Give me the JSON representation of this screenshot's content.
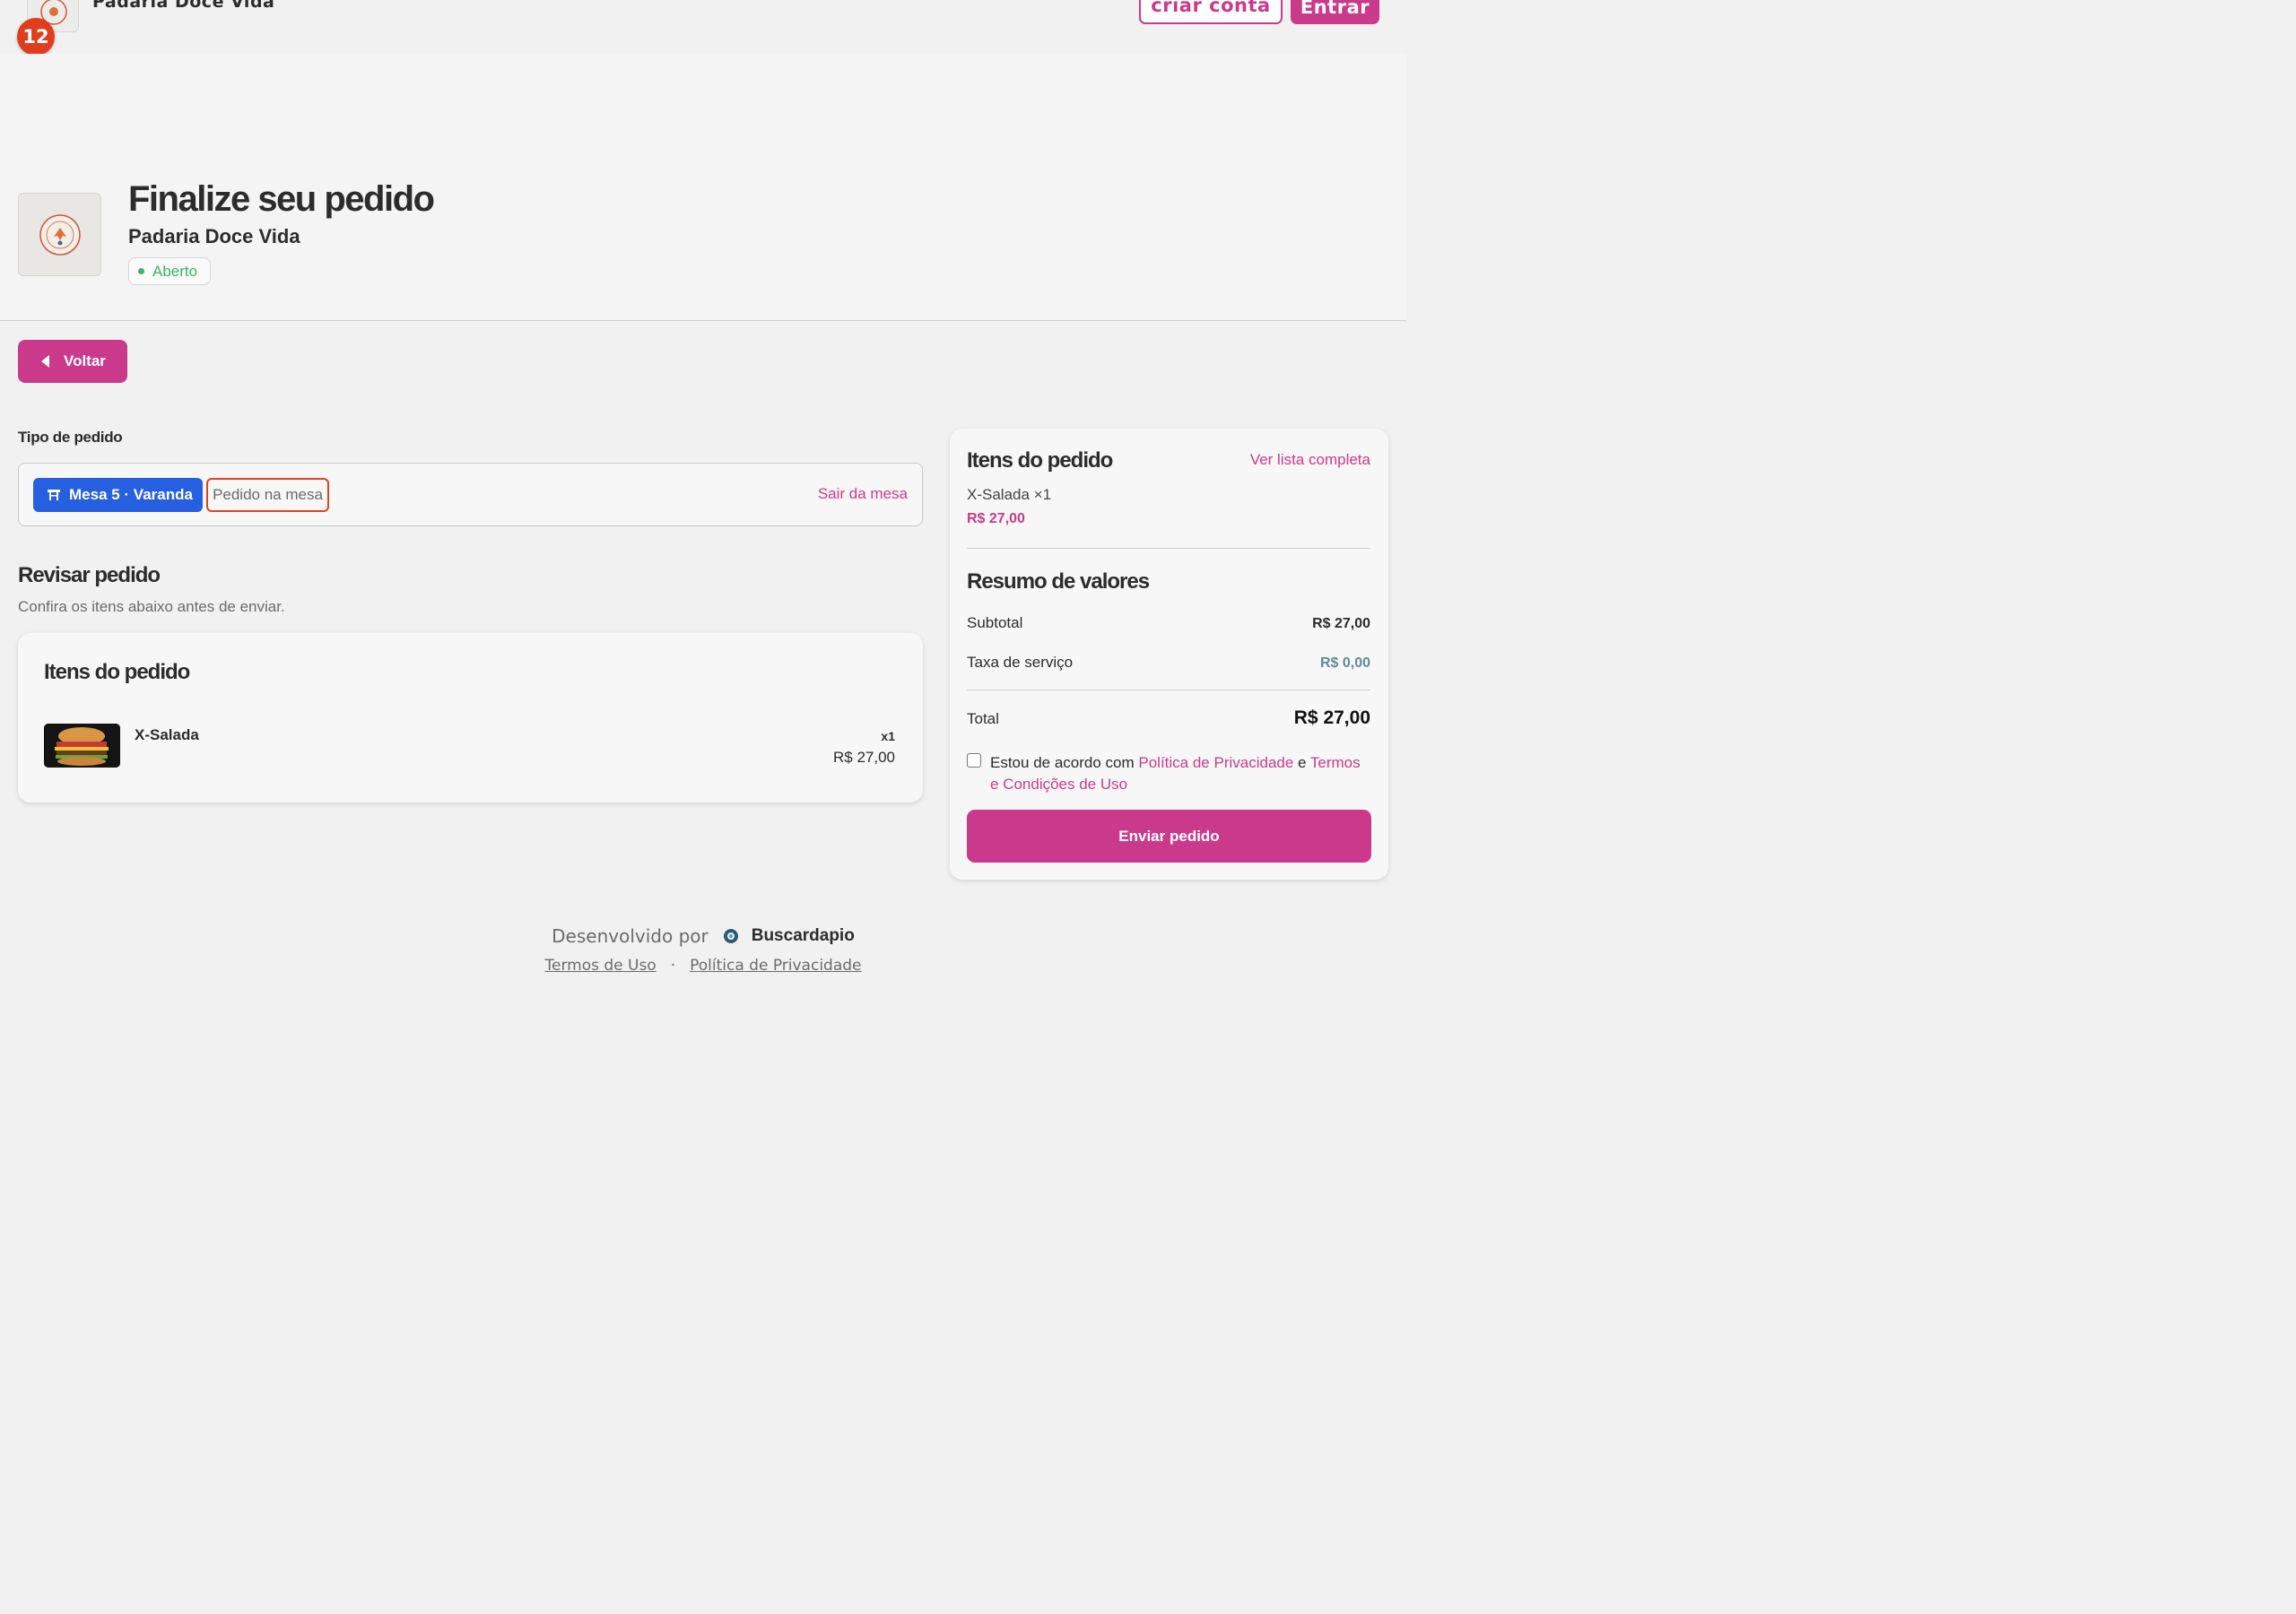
{
  "header": {
    "notification_count": "12",
    "brand_name": "Padaria Doce Vida",
    "criar_conta_label": "criar conta",
    "entrar_label": "Entrar"
  },
  "hero": {
    "title": "Finalize seu pedido",
    "store_name": "Padaria Doce Vida",
    "status": "Aberto"
  },
  "actions": {
    "voltar_label": "Voltar"
  },
  "order_type": {
    "label": "Tipo de pedido",
    "table_chip": "Mesa 5 · Varanda",
    "type_value": "Pedido na mesa",
    "leave_table": "Sair da mesa"
  },
  "review": {
    "title": "Revisar pedido",
    "subtitle": "Confira os itens abaixo antes de enviar.",
    "card_title": "Itens do pedido",
    "items": [
      {
        "name": "X-Salada",
        "qty": "x1",
        "price": "R$ 27,00"
      }
    ]
  },
  "summary": {
    "items_title": "Itens do pedido",
    "see_full_list": "Ver lista completa",
    "item_line": "X-Salada ×1",
    "item_price": "R$ 27,00",
    "values_title": "Resumo de valores",
    "subtotal_label": "Subtotal",
    "subtotal_value": "R$ 27,00",
    "service_label": "Taxa de serviço",
    "service_value": "R$ 0,00",
    "total_label": "Total",
    "total_value": "R$ 27,00",
    "agree_prefix": "Estou de acordo com ",
    "agree_privacy": "Política de Privacidade",
    "agree_and": " e ",
    "agree_terms": "Termos e Condições de Uso",
    "submit_label": "Enviar pedido"
  },
  "footer": {
    "developed_by": "Desenvolvido por",
    "brand": "Buscardapio",
    "terms": "Termos de Uso",
    "separator": "·",
    "privacy": "Política de Privacidade"
  },
  "colors": {
    "accent": "#cb3a8a",
    "table_chip": "#2660e0",
    "status_open": "#3cb26b",
    "highlight_border": "#e0431f"
  }
}
